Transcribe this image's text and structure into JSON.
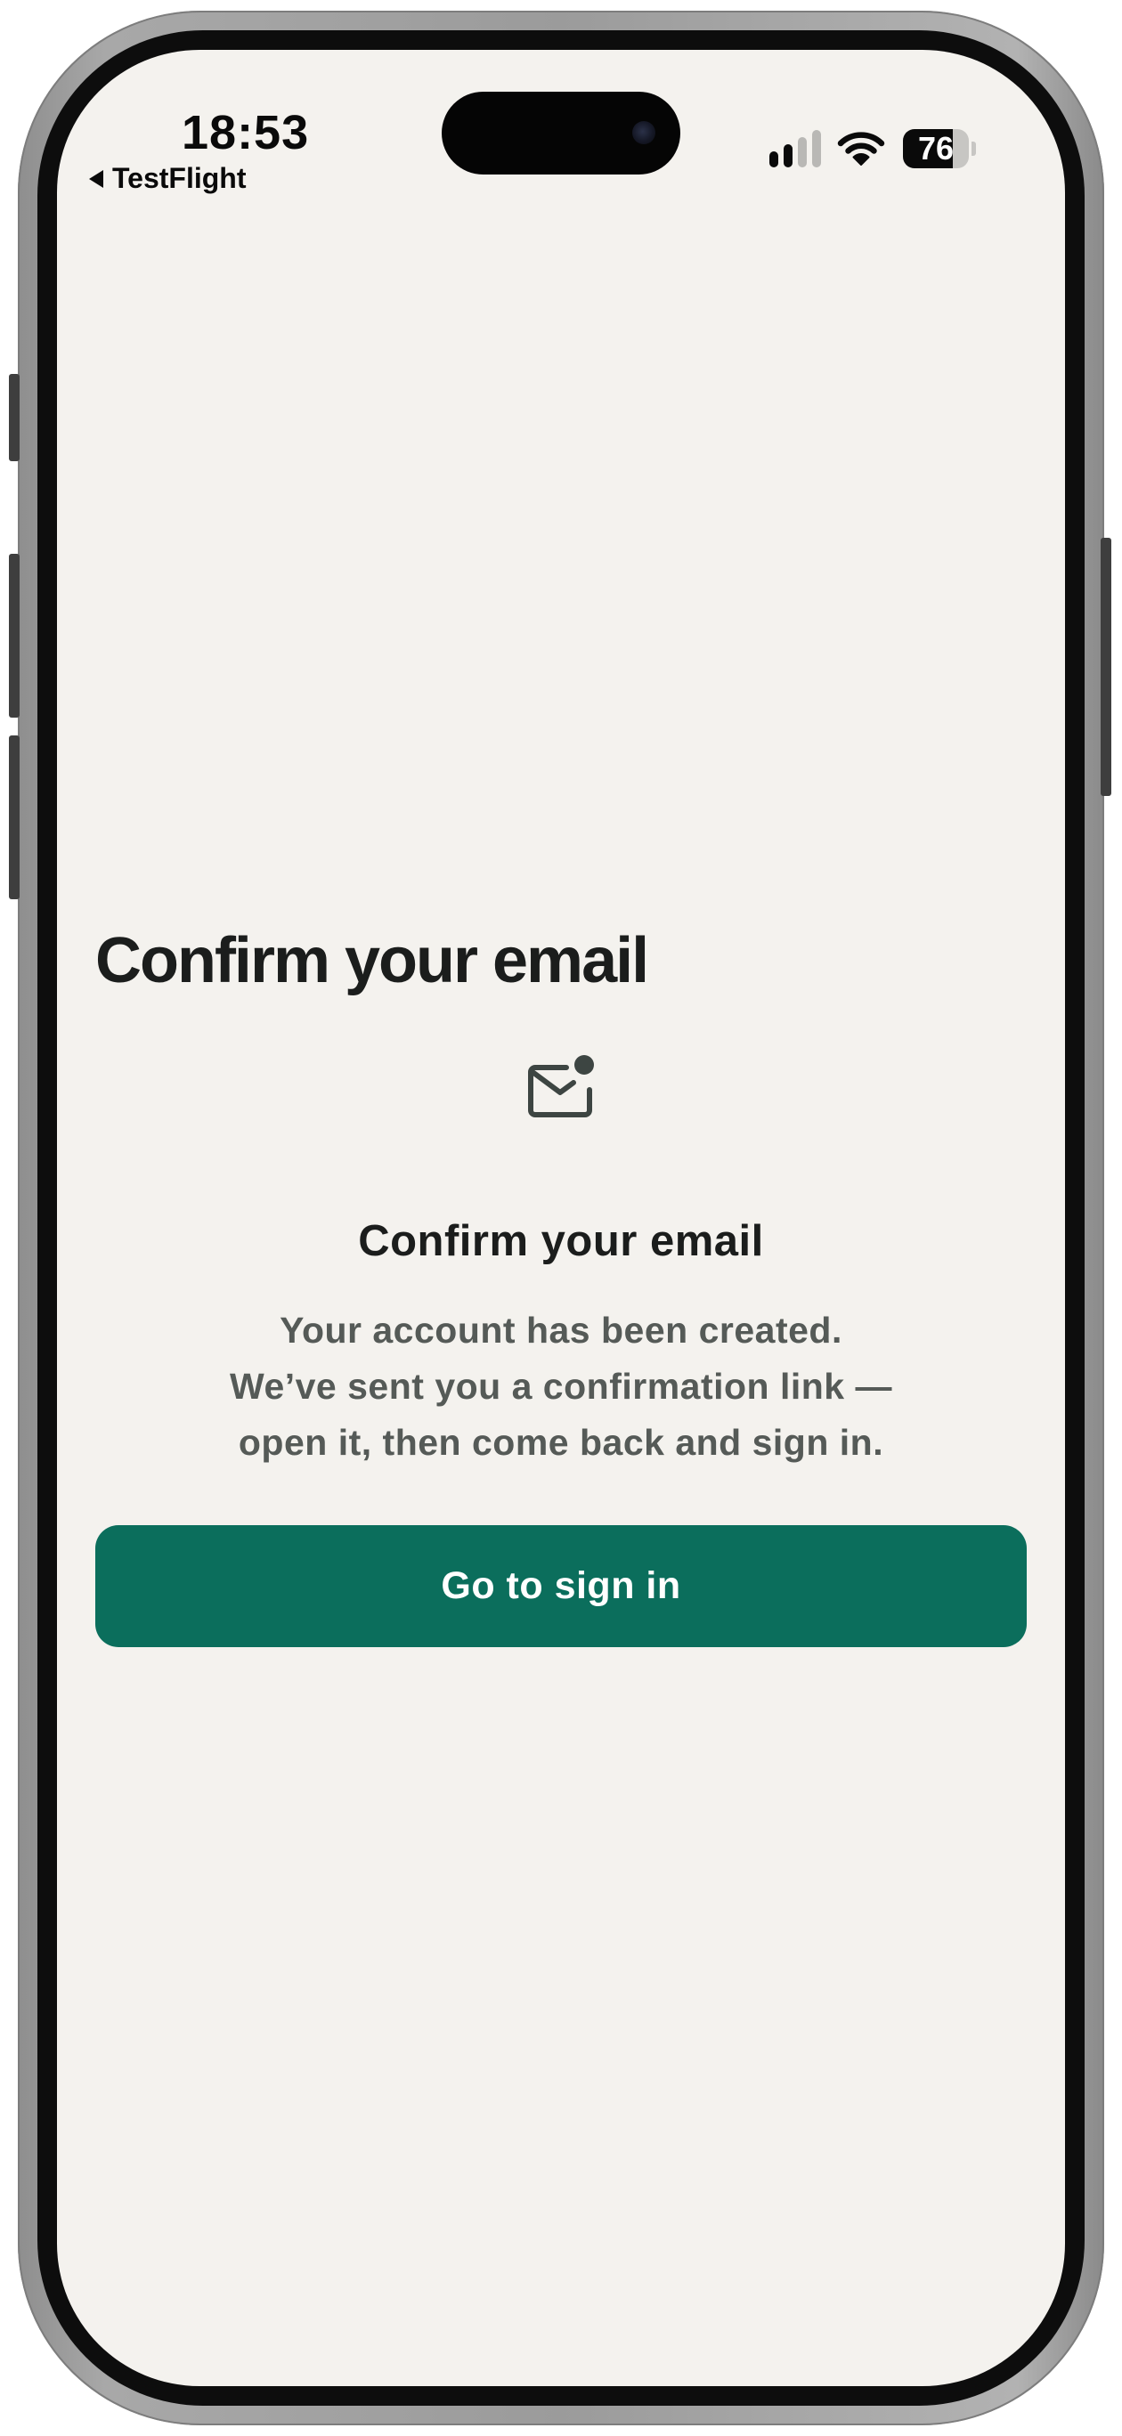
{
  "status_bar": {
    "time": "18:53",
    "back_app": "TestFlight",
    "battery_level": 76,
    "battery_percent_text": "76",
    "signal_bars_active": 2,
    "signal_bars_total": 4
  },
  "page": {
    "title": "Confirm your email"
  },
  "confirmation": {
    "icon": "mail-unread-icon",
    "heading": "Confirm your email",
    "message": "Your account has been created. We’ve sent you a confirmation link — open it, then come back and sign in."
  },
  "actions": {
    "go_to_sign_in_label": "Go to sign in"
  },
  "colors": {
    "background": "#f4f2ee",
    "accent": "#0b6e5c",
    "text_primary": "#1b1d1c",
    "text_secondary": "#555a57",
    "icon": "#3d4542"
  }
}
